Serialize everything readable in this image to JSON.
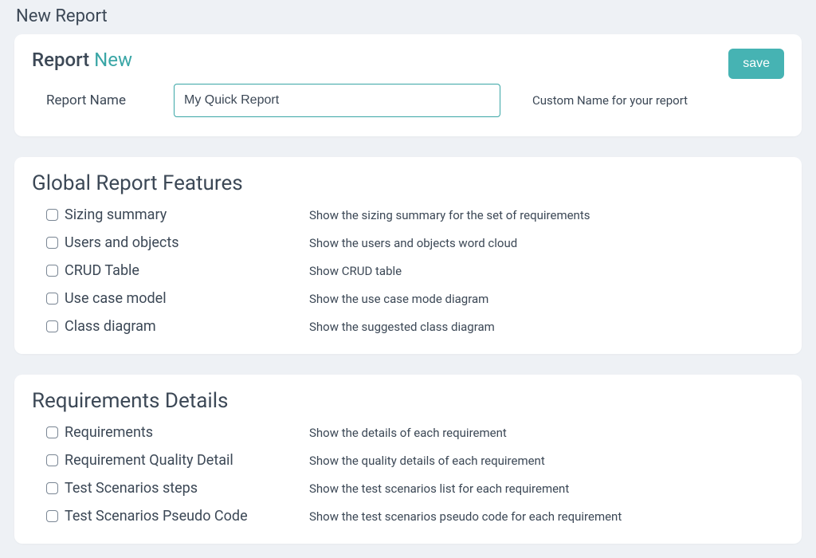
{
  "page": {
    "title": "New Report"
  },
  "report": {
    "heading_prefix": "Report",
    "heading_suffix": "New",
    "name_label": "Report Name",
    "name_value": "My Quick Report",
    "name_hint": "Custom Name for your report",
    "save_label": "save"
  },
  "global_section": {
    "title": "Global Report Features",
    "items": [
      {
        "label": "Sizing summary",
        "desc": "Show the sizing summary for the set of requirements"
      },
      {
        "label": "Users and objects",
        "desc": "Show the users and objects word cloud"
      },
      {
        "label": "CRUD Table",
        "desc": "Show CRUD table"
      },
      {
        "label": "Use case model",
        "desc": "Show the use case mode diagram"
      },
      {
        "label": "Class diagram",
        "desc": "Show the suggested class diagram"
      }
    ]
  },
  "requirements_section": {
    "title": "Requirements Details",
    "items": [
      {
        "label": "Requirements",
        "desc": "Show the details of each requirement"
      },
      {
        "label": "Requirement Quality Detail",
        "desc": "Show the quality details of each requirement"
      },
      {
        "label": "Test Scenarios steps",
        "desc": "Show the test scenarios list for each requirement"
      },
      {
        "label": "Test Scenarios Pseudo Code",
        "desc": "Show the test scenarios pseudo code for each requirement"
      }
    ]
  }
}
